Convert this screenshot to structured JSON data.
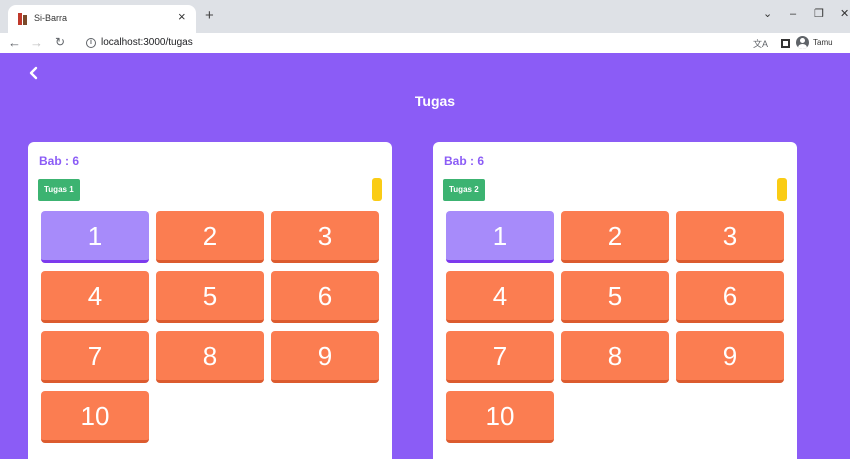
{
  "browser": {
    "tab_title": "Si-Barra",
    "tab_close": "×",
    "new_tab": "+",
    "url": "localhost:3000/tugas",
    "profile_label": "Tamu",
    "window": {
      "minimize": "–",
      "maximize": "❐",
      "close": "✕",
      "tab_list": "⌄"
    }
  },
  "app": {
    "page_title": "Tugas",
    "accent_color": "#8b5cf6",
    "cards": [
      {
        "bab": "Bab : 6",
        "tugas": "Tugas 1",
        "numbers": [
          "1",
          "2",
          "3",
          "4",
          "5",
          "6",
          "7",
          "8",
          "9",
          "10"
        ],
        "active": "1"
      },
      {
        "bab": "Bab : 6",
        "tugas": "Tugas 2",
        "numbers": [
          "1",
          "2",
          "3",
          "4",
          "5",
          "6",
          "7",
          "8",
          "9",
          "10"
        ],
        "active": "1"
      }
    ]
  }
}
